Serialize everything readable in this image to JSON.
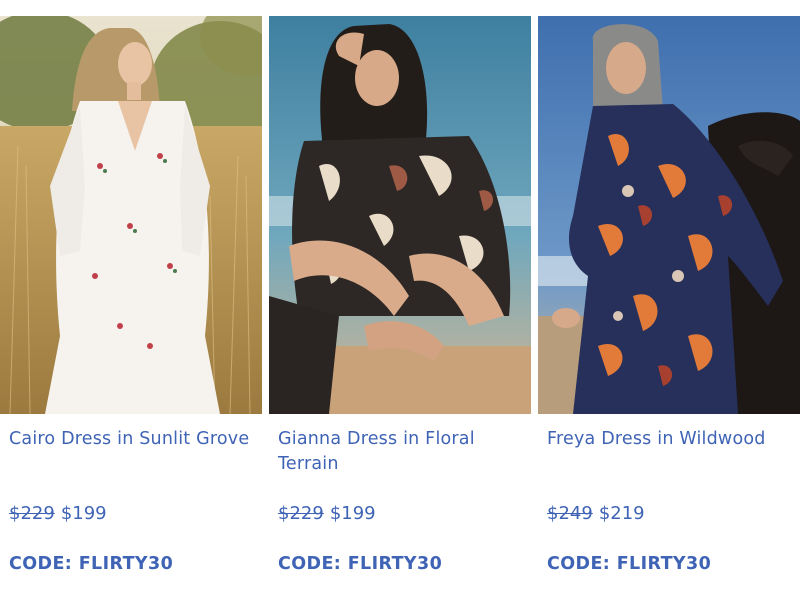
{
  "products": [
    {
      "name": "Cairo Dress in Sunlit Grove",
      "original_price": "$229",
      "sale_price": "$199",
      "promo_code": "CODE: FLIRTY30",
      "image": "photo of model in white embroidered dress standing in golden grass field"
    },
    {
      "name": "Gianna Dress in Floral Terrain",
      "original_price": "$229",
      "sale_price": "$199",
      "promo_code": "CODE: FLIRTY30",
      "image": "photo of model in black and cream floral print dress sitting on beach"
    },
    {
      "name": "Freya Dress in Wildwood",
      "original_price": "$249",
      "sale_price": "$219",
      "promo_code": "CODE: FLIRTY30",
      "image": "photo of model in navy and orange print dress leaning on dark rock by sea"
    }
  ],
  "colors": {
    "text_accent": "#3f63b5"
  }
}
